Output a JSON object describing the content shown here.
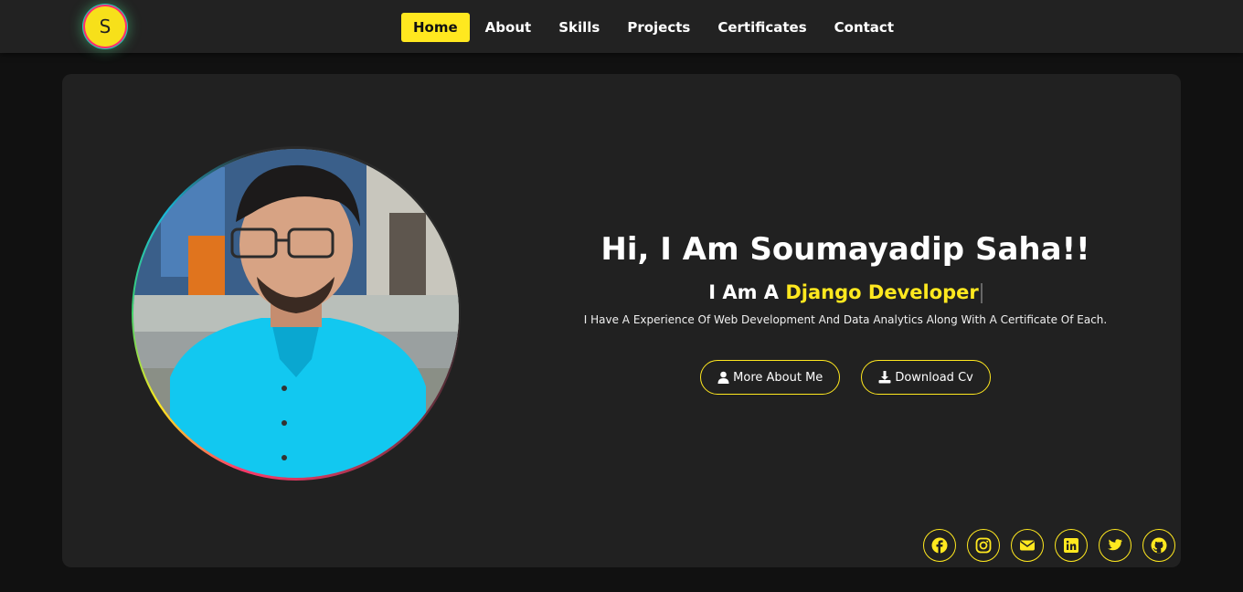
{
  "brand": {
    "logo_letter": "S"
  },
  "nav": {
    "items": [
      {
        "label": "Home",
        "active": true
      },
      {
        "label": "About"
      },
      {
        "label": "Skills"
      },
      {
        "label": "Projects"
      },
      {
        "label": "Certificates"
      },
      {
        "label": "Contact"
      }
    ]
  },
  "hero": {
    "title": "Hi, I Am Soumayadip Saha!!",
    "subtitle_prefix": "I Am A ",
    "subtitle_role": "Django Developer",
    "description": "I Have A Experience Of Web Development And Data Analytics Along With A Certificate Of Each.",
    "buttons": {
      "about": {
        "label": "More About Me",
        "icon": "user-icon"
      },
      "cv": {
        "label": "Download Cv",
        "icon": "download-icon"
      }
    }
  },
  "socials": [
    "facebook-icon",
    "instagram-icon",
    "email-icon",
    "linkedin-icon",
    "twitter-icon",
    "github-icon"
  ],
  "colors": {
    "accent": "#ffe81f",
    "background": "#111111",
    "navbar": "#222222",
    "card": "#212121"
  }
}
